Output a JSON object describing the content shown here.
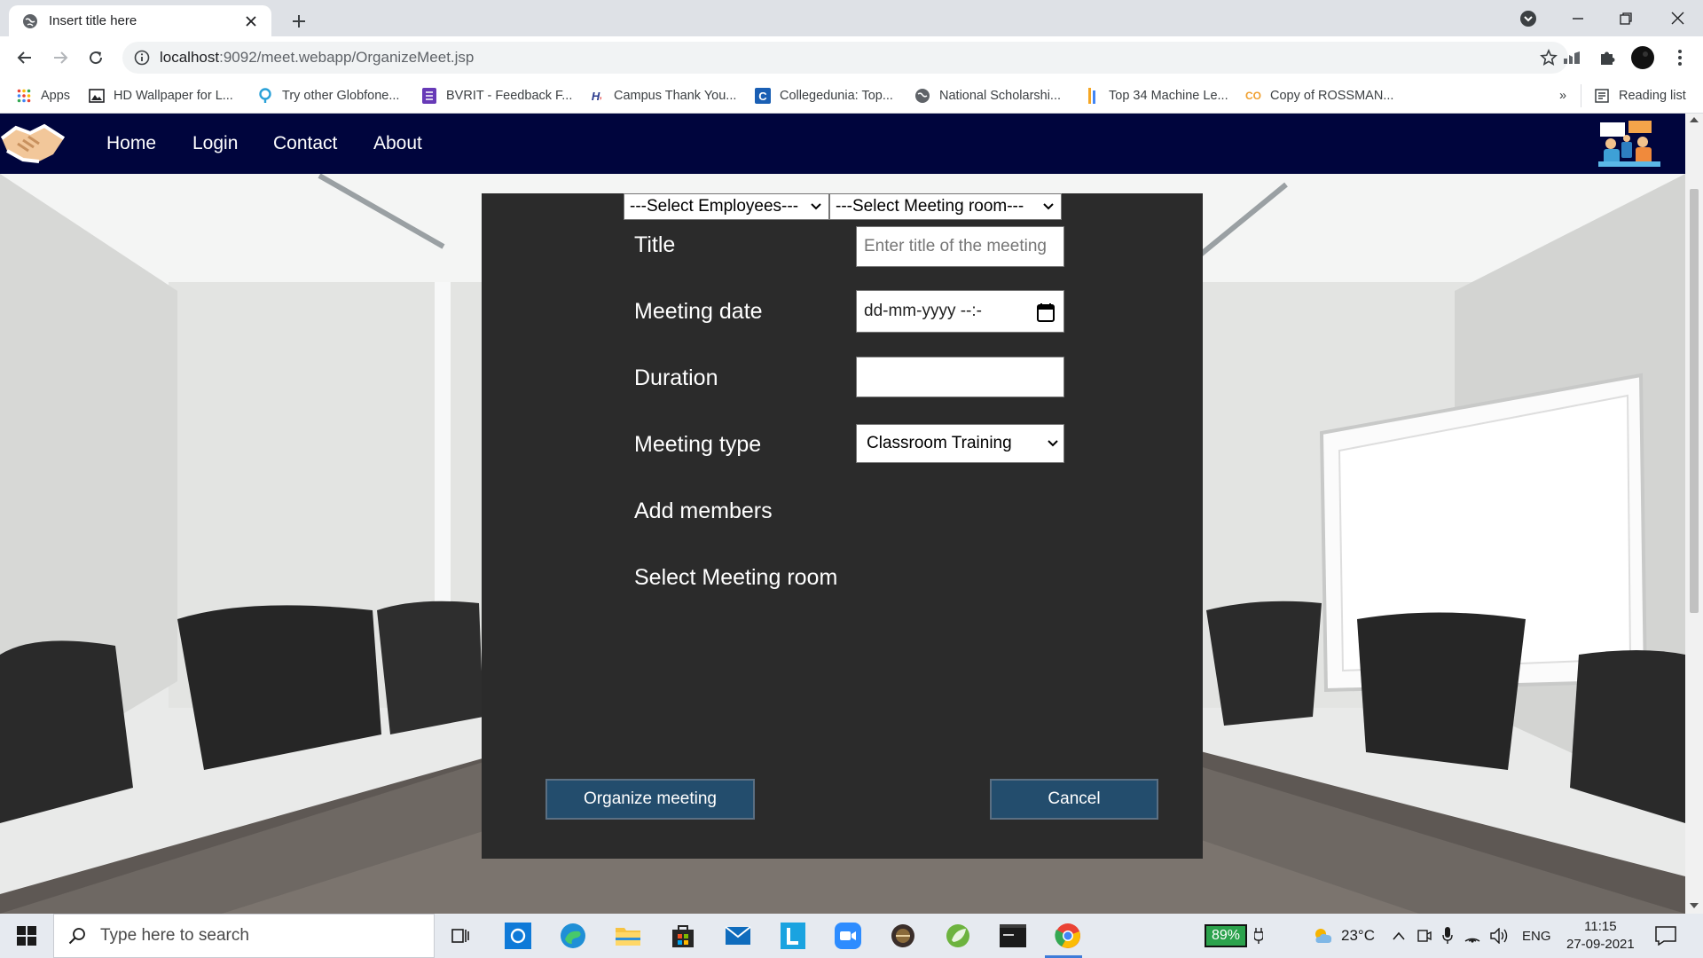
{
  "browser": {
    "tab_title": "Insert title here",
    "url_host": "localhost",
    "url_path": ":9092/meet.webapp/OrganizeMeet.jsp",
    "reading_list": "Reading list",
    "more_bookmarks": "»"
  },
  "bookmarks": [
    {
      "label": "Apps",
      "icon": "apps-grid-icon",
      "color": "#ea4335"
    },
    {
      "label": "HD Wallpaper for L...",
      "icon": "image-icon",
      "color": "#202124"
    },
    {
      "label": "Try other Globfone...",
      "icon": "globfone-icon",
      "color": "#2aa1d8"
    },
    {
      "label": "BVRIT - Feedback F...",
      "icon": "forms-icon",
      "color": "#673ab7"
    },
    {
      "label": "Campus Thank You...",
      "icon": "hackerearth-icon",
      "color": "#2a3a8c"
    },
    {
      "label": "Collegedunia: Top...",
      "icon": "collegedunia-icon",
      "color": "#1a5fb4"
    },
    {
      "label": "National Scholarshi...",
      "icon": "globe-icon",
      "color": "#5f6368"
    },
    {
      "label": "Top 34 Machine Le...",
      "icon": "bookmark-bar-icon",
      "color": "#f5a623"
    },
    {
      "label": "Copy of ROSSMAN...",
      "icon": "co-icon",
      "color": "#f0a030"
    }
  ],
  "nav": {
    "links": [
      "Home",
      "Login",
      "Contact",
      "About"
    ]
  },
  "form": {
    "employees_select": "---Select Employees---",
    "room_select": "---Select Meeting room---",
    "labels": {
      "title": "Title",
      "date": "Meeting date",
      "duration": "Duration",
      "type": "Meeting type",
      "members": "Add members",
      "room": "Select Meeting room"
    },
    "title_placeholder": "Enter title of the meeting",
    "date_placeholder": "dd-mm-yyyy --:-",
    "duration_value": "",
    "meeting_type": "Classroom Training",
    "submit": "Organize meeting",
    "cancel": "Cancel"
  },
  "taskbar": {
    "search_placeholder": "Type here to search",
    "battery": "89%",
    "temperature": "23°C",
    "language": "ENG",
    "time": "11:15",
    "date": "27-09-2021"
  },
  "colors": {
    "navbar": "#00053d",
    "panel": "#2b2b2b",
    "button": "#234d6d"
  }
}
